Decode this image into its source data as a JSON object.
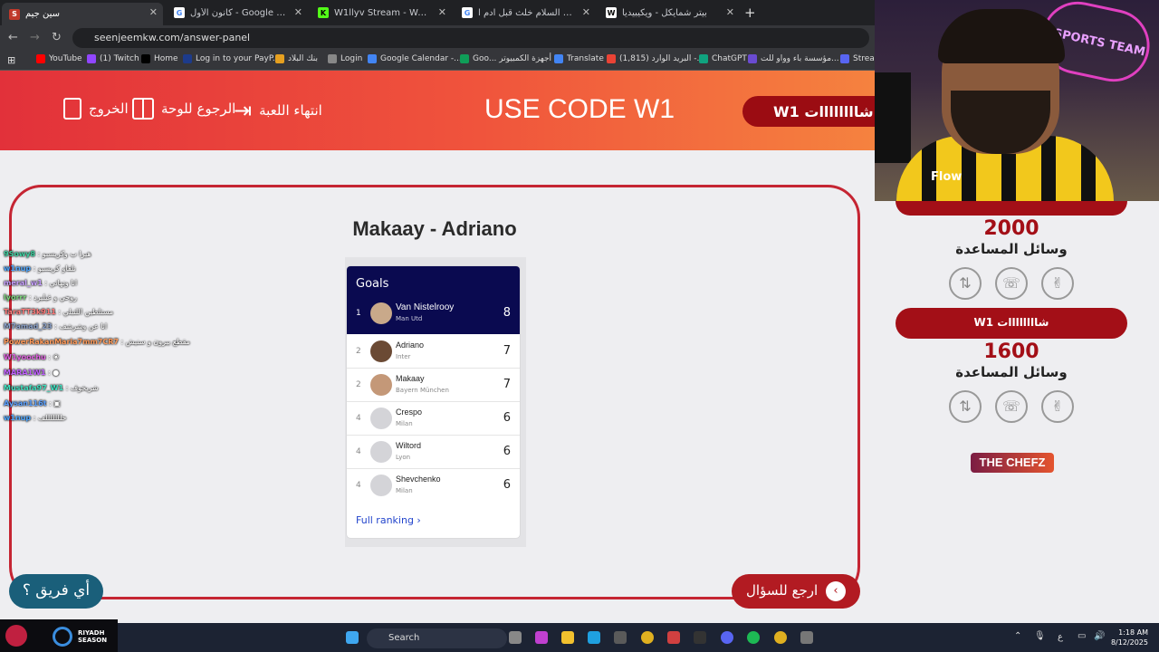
{
  "browser": {
    "tabs": [
      {
        "title": "سين جيم",
        "active": true
      },
      {
        "title": "كانون الأول - Google Search"
      },
      {
        "title": "W1llyv Stream - Watch Live on"
      },
      {
        "title": "جبريل عليه السلام خلث قبل ادم ا"
      },
      {
        "title": "بيتر شمايكل - ويكيبيديا"
      }
    ],
    "url": "seenjeemkw.com/answer-panel",
    "bookmarks": [
      "YouTube",
      "(1) Twitch",
      "Home",
      "Log in to your PayP...",
      "بنك البلاد",
      "Login",
      "Google Calendar -...",
      "Goo... أجهزة الكمبيوتر",
      "Translate",
      "البريد الوارد (1,815) -...",
      "ChatGPT",
      "مؤسسة باء وواو للت...",
      "Stream"
    ]
  },
  "header": {
    "code_text": "USE CODE W1",
    "end_game": "انتهاء اللعبة",
    "back_to_board": "الرجوع للوحة",
    "exit": "الخروج",
    "team_pill": "W1 شاااااااات"
  },
  "question": {
    "title": "Makaay - Adriano"
  },
  "ranking": {
    "heading": "Goals",
    "rows": [
      {
        "rank": "1",
        "name": "Van Nistelrooy",
        "club": "Man Utd",
        "goals": "8"
      },
      {
        "rank": "2",
        "name": "Adriano",
        "club": "Inter",
        "goals": "7"
      },
      {
        "rank": "2",
        "name": "Makaay",
        "club": "Bayern München",
        "goals": "7"
      },
      {
        "rank": "4",
        "name": "Crespo",
        "club": "Milan",
        "goals": "6"
      },
      {
        "rank": "4",
        "name": "Wiltord",
        "club": "Lyon",
        "goals": "6"
      },
      {
        "rank": "4",
        "name": "Shevchenko",
        "club": "Milan",
        "goals": "6"
      }
    ],
    "full_ranking": "Full ranking"
  },
  "teams": [
    {
      "score": "2000",
      "aids_label": "وسائل المساعدة"
    },
    {
      "name": "W1 شاااااااات",
      "score": "1600",
      "aids_label": "وسائل المساعدة"
    }
  ],
  "sponsor": "THE CHEFZ",
  "buttons": {
    "which_team": "أي فريق ؟",
    "back_to_question": "ارجع للسؤال"
  },
  "chat": [
    {
      "user": "9Sowy8",
      "msg": "هيرا ب وكريسبو"
    },
    {
      "user": "w1nup",
      "msg": "نلفاو كريسبو"
    },
    {
      "user": "meral_w1",
      "msg": "انا ونهاتي"
    },
    {
      "user": "lyorrr",
      "msg": "روحي و غيليرد"
    },
    {
      "user": "TaraTT3k911",
      "msg": "مستلطين اللتبلي"
    },
    {
      "user": "M7amad_23",
      "msg": "انا عن وشرشف"
    },
    {
      "user": "PowerRakanMaria7mm7CR7",
      "msg": "مقطع بيرون و سنيش"
    },
    {
      "user": "W1yoochu",
      "msg": ""
    },
    {
      "user": "MARA1W1",
      "msg": ""
    },
    {
      "user": "Mustafa97_W1",
      "msg": "شريخوف"
    },
    {
      "user": "Aysan116t",
      "msg": ""
    },
    {
      "user": "w1nup",
      "msg": "خلللللللف"
    }
  ],
  "webcam": {
    "neon_text": "ESPORTS TEAM",
    "shirt_text": "Flow"
  },
  "taskbar": {
    "riyadh_label": "RIYADH SEASON",
    "search_placeholder": "Search",
    "time": "1:18 AM",
    "date": "8/12/2025",
    "lang": "ع"
  }
}
